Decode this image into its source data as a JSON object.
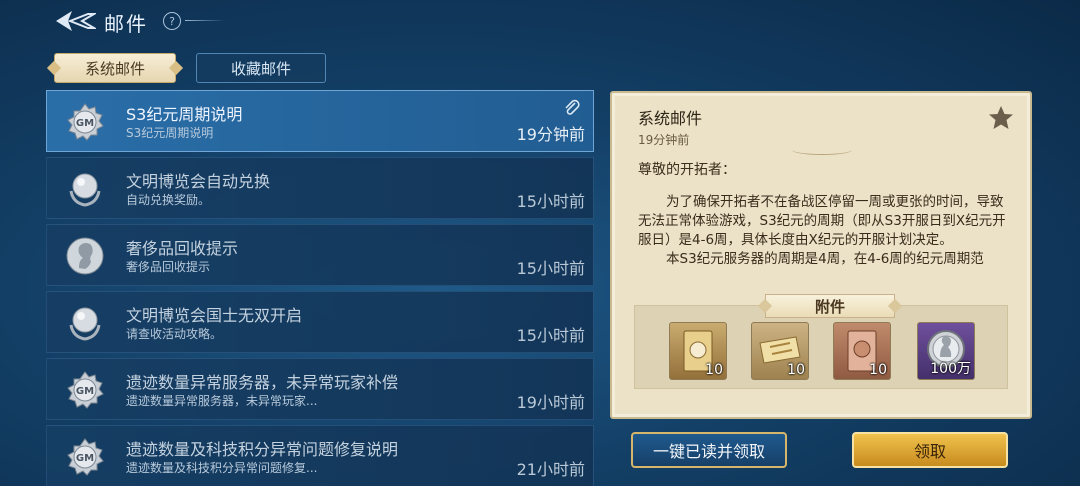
{
  "header": {
    "title": "邮件",
    "help": "?"
  },
  "tabs": [
    {
      "label": "系统邮件"
    },
    {
      "label": "收藏邮件"
    }
  ],
  "mails": [
    {
      "title": "S3纪元周期说明",
      "subtitle": "S3纪元周期说明",
      "time": "19分钟前",
      "icon": "gm-badge-icon"
    },
    {
      "title": "文明博览会自动兑换",
      "subtitle": "自动兑换奖励。",
      "time": "15小时前",
      "icon": "silver-orb-laurel-icon"
    },
    {
      "title": "奢侈品回收提示",
      "subtitle": "奢侈品回收提示",
      "time": "15小时前",
      "icon": "bust-portrait-icon"
    },
    {
      "title": "文明博览会国士无双开启",
      "subtitle": "请查收活动攻略。",
      "time": "15小时前",
      "icon": "silver-orb-laurel-icon"
    },
    {
      "title": "遗迹数量异常服务器，未异常玩家补偿",
      "subtitle": "遗迹数量异常服务器，未异常玩家...",
      "time": "19小时前",
      "icon": "gm-badge-icon"
    },
    {
      "title": "遗迹数量及科技积分异常问题修复说明",
      "subtitle": "遗迹数量及科技积分异常问题修复...",
      "time": "21小时前",
      "icon": "gm-badge-icon"
    }
  ],
  "detail": {
    "title": "系统邮件",
    "time": "19分钟前",
    "greeting": "尊敬的开拓者：",
    "paragraph1": "为了确保开拓者不在备战区停留一周或更张的时间，导致无法正常体验游戏，S3纪元的周期（即从S3开服日到X纪元开服日）是4-6周，具体长度由X纪元的开服计划决定。",
    "paragraph2": "本S3纪元服务器的周期是4周，在4-6周的纪元周期范",
    "attachment_label": "附件",
    "rewards": [
      {
        "count": "10",
        "icon": "gold-card-icon"
      },
      {
        "count": "10",
        "icon": "gold-ticket-icon"
      },
      {
        "count": "10",
        "icon": "bronze-card-icon"
      },
      {
        "count": "100万",
        "icon": "silver-coin-icon"
      }
    ]
  },
  "buttons": {
    "read_all": "一键已读并领取",
    "claim": "领取"
  },
  "colors": {
    "background": "#133f66",
    "selected_row": "#2a6ea8",
    "parchment": "#ebe2c8",
    "gold_button": "#f1c24d"
  }
}
